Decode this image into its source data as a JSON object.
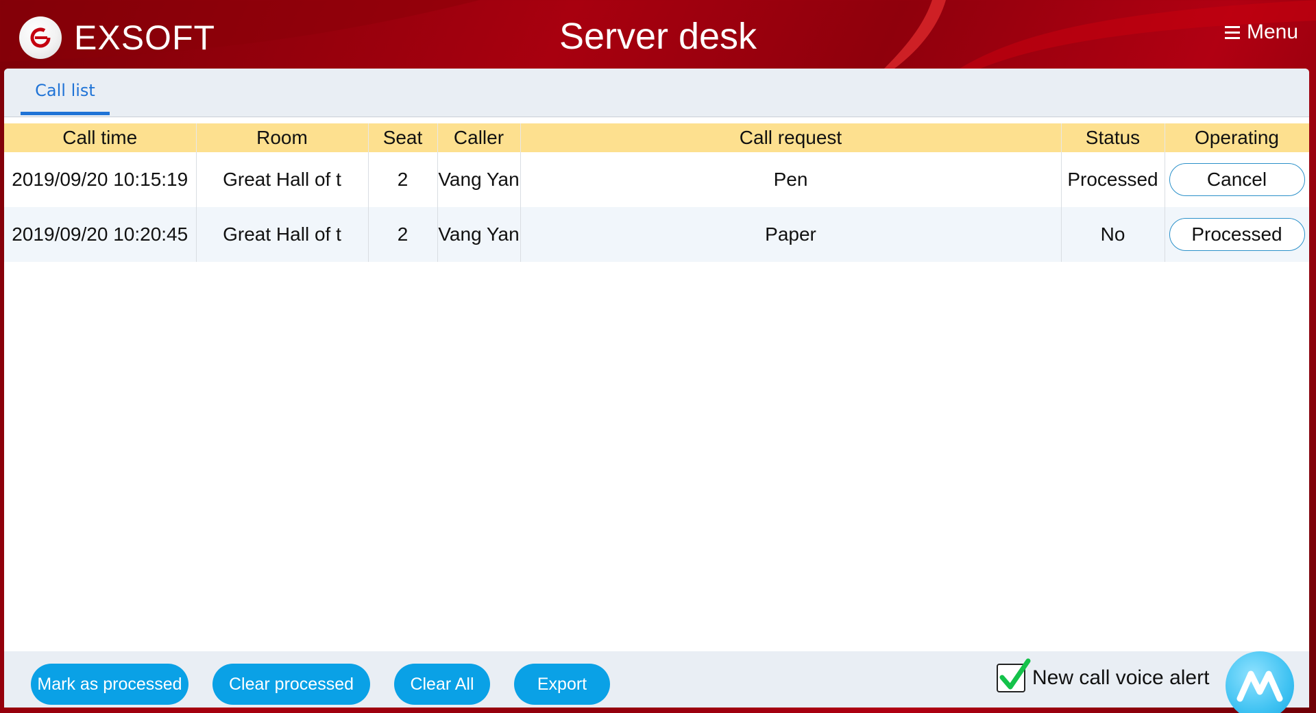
{
  "header": {
    "logo_text": "EXSOFT",
    "title": "Server desk",
    "menu_label": "Menu"
  },
  "tabs": [
    {
      "label": "Call list",
      "active": true
    }
  ],
  "table": {
    "columns": [
      "Call time",
      "Room",
      "Seat",
      "Caller",
      "Call request",
      "Status",
      "Operating"
    ],
    "rows": [
      {
        "call_time": "2019/09/20 10:15:19",
        "room": "Great Hall of t",
        "seat": "2",
        "caller": "Vang Yan",
        "request": "Pen",
        "status": "Processed",
        "action": "Cancel"
      },
      {
        "call_time": "2019/09/20 10:20:45",
        "room": "Great Hall of t",
        "seat": "2",
        "caller": "Vang Yan",
        "request": "Paper",
        "status": "No",
        "action": "Processed"
      }
    ]
  },
  "footer": {
    "mark_processed": "Mark as processed",
    "clear_processed": "Clear processed",
    "clear_all": "Clear All",
    "export": "Export",
    "voice_alert_label": "New call voice alert",
    "voice_alert_checked": true
  },
  "colors": {
    "header_red": "#a8000f",
    "tab_blue": "#1f73d6",
    "table_header": "#fde08f",
    "button_blue": "#0aa1e6",
    "status_processed": "#19a84a",
    "status_no": "#e01919"
  }
}
